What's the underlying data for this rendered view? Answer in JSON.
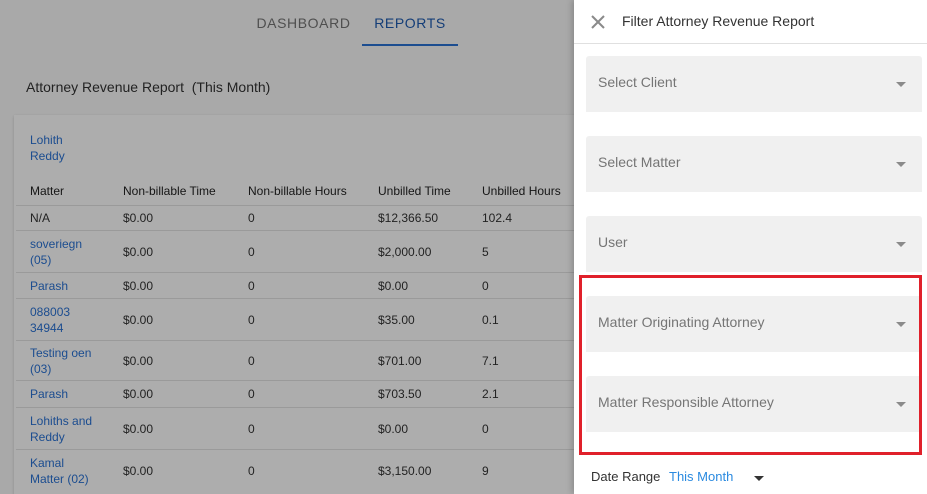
{
  "nav": {
    "tabs": [
      {
        "label": "DASHBOARD"
      },
      {
        "label": "REPORTS"
      }
    ]
  },
  "report": {
    "title": "Attorney Revenue Report  (This Month)",
    "attorney": "Lohith Reddy",
    "columns": [
      "Matter",
      "Non-billable Time",
      "Non-billable Hours",
      "Unbilled Time",
      "Unbilled Hours"
    ],
    "rows": [
      {
        "matter": "N/A",
        "nb_time": "$0.00",
        "nb_hours": "0",
        "ub_time": "$12,366.50",
        "ub_hours": "102.4"
      },
      {
        "matter": "soveriegn (05)",
        "nb_time": "$0.00",
        "nb_hours": "0",
        "ub_time": "$2,000.00",
        "ub_hours": "5"
      },
      {
        "matter": "Parash",
        "nb_time": "$0.00",
        "nb_hours": "0",
        "ub_time": "$0.00",
        "ub_hours": "0"
      },
      {
        "matter": "088003 34944",
        "nb_time": "$0.00",
        "nb_hours": "0",
        "ub_time": "$35.00",
        "ub_hours": "0.1"
      },
      {
        "matter": "Testing oen (03)",
        "nb_time": "$0.00",
        "nb_hours": "0",
        "ub_time": "$701.00",
        "ub_hours": "7.1"
      },
      {
        "matter": "Parash",
        "nb_time": "$0.00",
        "nb_hours": "0",
        "ub_time": "$703.50",
        "ub_hours": "2.1"
      },
      {
        "matter": "Lohiths and Reddy",
        "nb_time": "$0.00",
        "nb_hours": "0",
        "ub_time": "$0.00",
        "ub_hours": "0"
      },
      {
        "matter": "Kamal Matter (02)",
        "nb_time": "$0.00",
        "nb_hours": "0",
        "ub_time": "$3,150.00",
        "ub_hours": "9"
      }
    ]
  },
  "drawer": {
    "title": "Filter Attorney Revenue Report",
    "fields": [
      {
        "label": "Select Client"
      },
      {
        "label": "Select Matter"
      },
      {
        "label": "User"
      },
      {
        "label": "Matter Originating Attorney"
      },
      {
        "label": "Matter Responsible Attorney"
      }
    ],
    "date_range_label": "Date Range",
    "date_range_value": "This Month"
  },
  "colors": {
    "accent": "#2a72d4",
    "highlight": "#e0202a",
    "date_value": "#2a8ae0"
  }
}
